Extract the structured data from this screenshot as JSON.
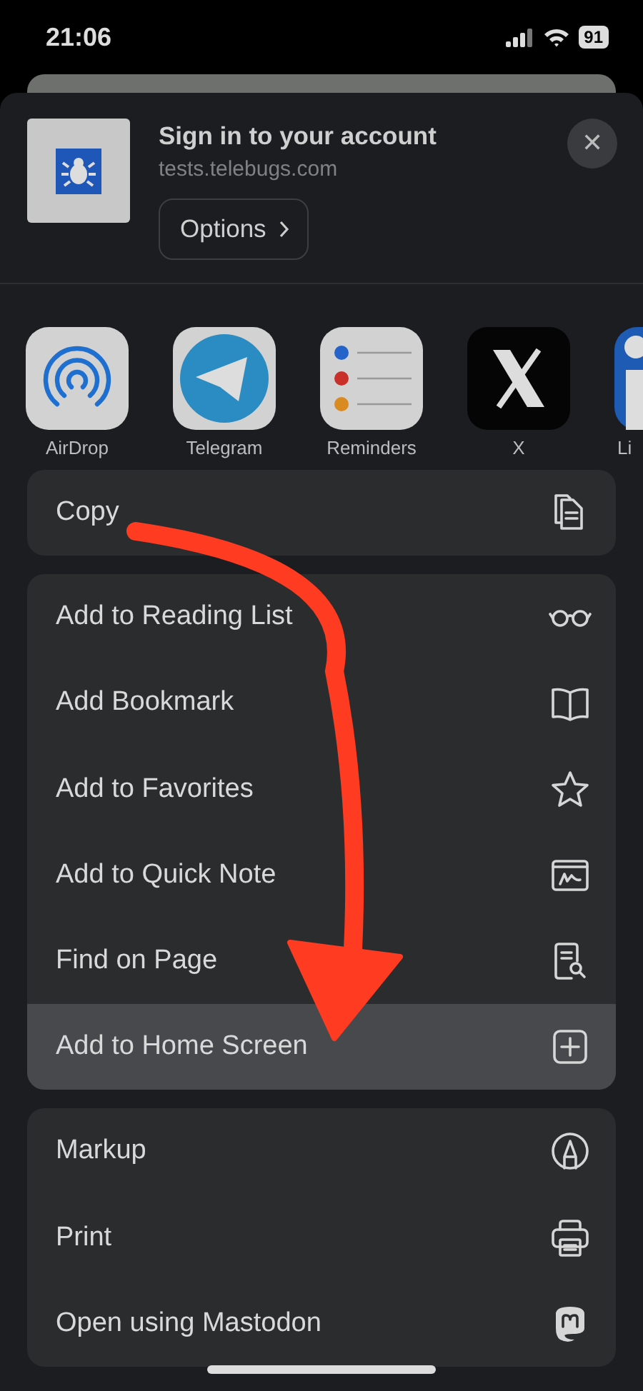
{
  "status_bar": {
    "time": "21:06",
    "battery": "91"
  },
  "header": {
    "title": "Sign in to your account",
    "url": "tests.telebugs.com",
    "options_button": "Options",
    "close_button": "✕"
  },
  "apps": [
    {
      "label": "AirDrop"
    },
    {
      "label": "Telegram"
    },
    {
      "label": "Reminders"
    },
    {
      "label": "X"
    },
    {
      "label": "Li"
    }
  ],
  "action_groups": [
    {
      "actions": [
        {
          "label": "Copy",
          "selected": false
        }
      ]
    },
    {
      "actions": [
        {
          "label": "Add to Reading List",
          "selected": false
        },
        {
          "label": "Add Bookmark",
          "selected": false
        },
        {
          "label": "Add to Favorites",
          "selected": false
        },
        {
          "label": "Add to Quick Note",
          "selected": false
        },
        {
          "label": "Find on Page",
          "selected": false
        },
        {
          "label": "Add to Home Screen",
          "selected": true
        }
      ]
    },
    {
      "actions": [
        {
          "label": "Markup",
          "selected": false
        },
        {
          "label": "Print",
          "selected": false
        },
        {
          "label": "Open using Mastodon",
          "selected": false
        }
      ]
    }
  ]
}
